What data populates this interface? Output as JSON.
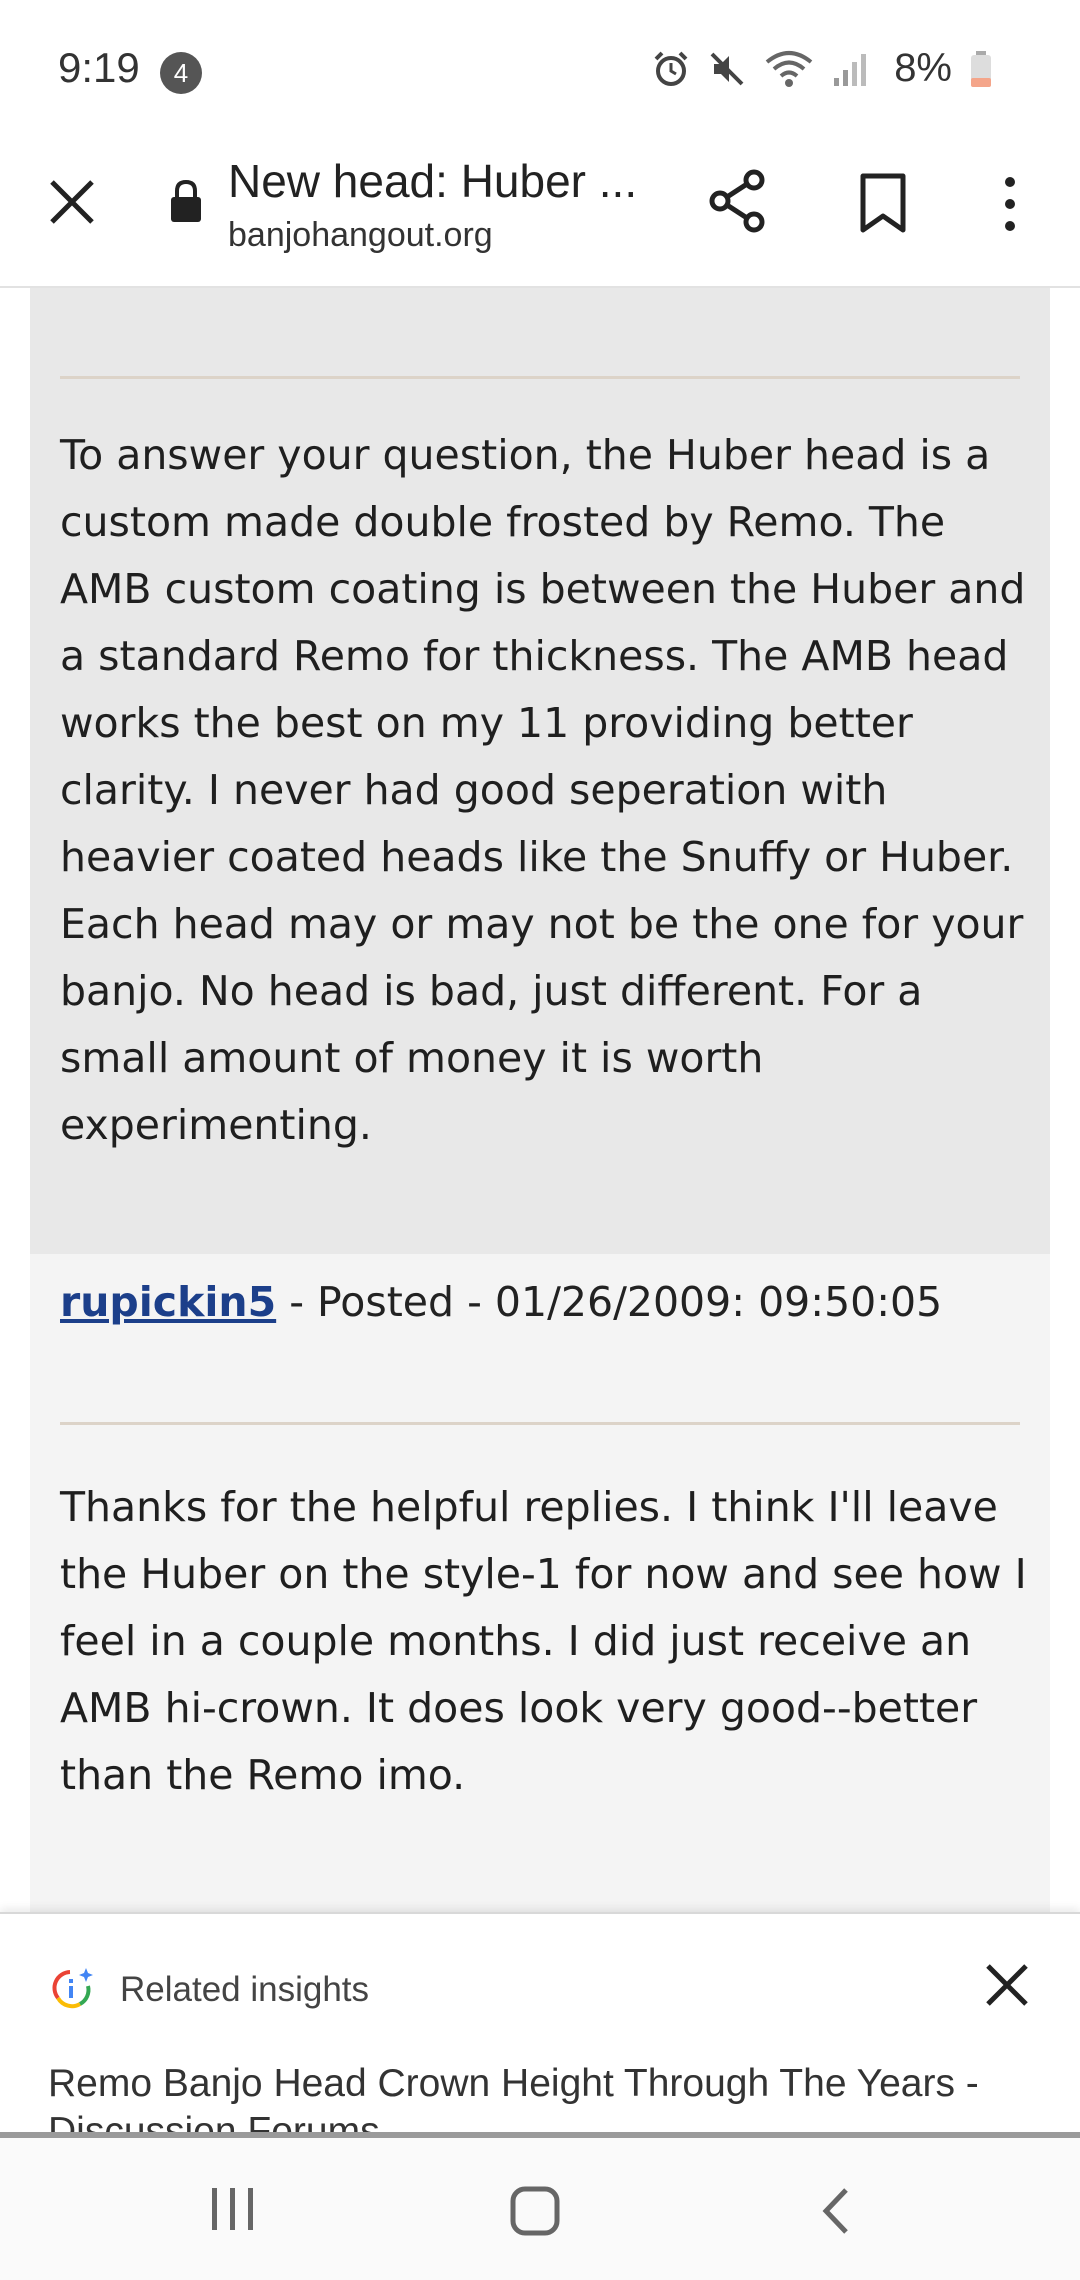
{
  "status_bar": {
    "time": "9:19",
    "notification_count": "4",
    "battery_percent": "8%",
    "icons": [
      "alarm-icon",
      "mute-icon",
      "wifi-icon",
      "signal-icon",
      "battery-icon"
    ],
    "battery_color": "#f4a58a"
  },
  "toolbar": {
    "title": "New head: Huber ...",
    "url": "banjohangout.org",
    "icons": [
      "close-icon",
      "lock-icon",
      "share-icon",
      "bookmark-icon",
      "more-icon"
    ]
  },
  "posts": [
    {
      "body": "To answer your question, the Huber head is a custom made double frosted by Remo. The AMB custom coating is between the Huber and a standard Remo for thickness. The AMB head works the best on my 11 providing better clarity. I never had good seperation with heavier coated heads like the Snuffy or Huber. Each head may or may not be the one for your banjo. No head is bad, just different. For a small amount of money it is worth experimenting."
    },
    {
      "author": "rupickin5",
      "posted_prefix": " - Posted - ",
      "posted_date": "01/26/2009:  09:50:05",
      "body": "Thanks for the helpful replies. I think I'll leave the Huber on the style-1 for now and see how I feel in a couple months. I did just receive an AMB hi-crown. It does look very good--better than the Remo imo."
    }
  ],
  "insights": {
    "label": "Related insights",
    "link_text": "Remo Banjo Head Crown Height Through The Years - Discussion Forums"
  },
  "colors": {
    "post_bg_primary": "#e8e8e8",
    "post_bg_secondary": "#f4f4f4",
    "link": "#1c3f8a",
    "divider": "#dcd3c8"
  }
}
